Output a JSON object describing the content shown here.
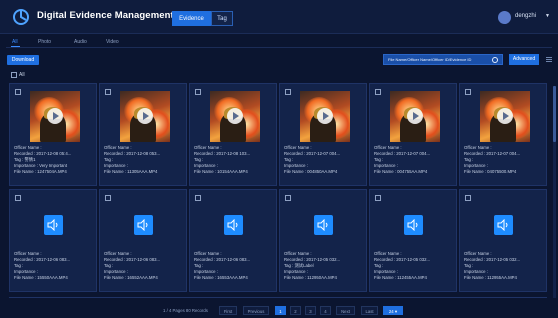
{
  "header": {
    "app_title": "Digital Evidence Management",
    "tabs": [
      {
        "label": "Evidence",
        "active": true
      },
      {
        "label": "Tag",
        "active": false
      }
    ],
    "user": {
      "name": "dengzhi"
    }
  },
  "filter_tabs": [
    {
      "label": "All",
      "active": true
    },
    {
      "label": "Photo",
      "active": false
    },
    {
      "label": "Audio",
      "active": false
    },
    {
      "label": "Video",
      "active": false
    }
  ],
  "toolbar": {
    "download_label": "Download",
    "search_placeholder": "File Name/Officer Name/Officer ID/Evidence ID",
    "advanced_label": "Advanced"
  },
  "select_all_label": "All",
  "cards": [
    {
      "type": "video",
      "officer": "Officer Name :",
      "recorded": "Recorded : 2017-12-08 05:4...",
      "tag": "Tag : 警情1",
      "importance": "Importance : Very Important",
      "file": "File Name : 1247504A.MP4"
    },
    {
      "type": "video",
      "officer": "Officer Name :",
      "recorded": "Recorded : 2017-12-08 053...",
      "tag": "Tag :",
      "importance": "Importance :",
      "file": "File Name : 11305AAA.MP4"
    },
    {
      "type": "video",
      "officer": "Officer Name :",
      "recorded": "Recorded : 2017-12-08 103...",
      "tag": "Tag :",
      "importance": "Importance :",
      "file": "File Name : 10154AAA.MP4"
    },
    {
      "type": "video",
      "officer": "Officer Name :",
      "recorded": "Recorded : 2017-12-07 004...",
      "tag": "Tag :",
      "importance": "Importance :",
      "file": "File Name : 004850AA.MP4"
    },
    {
      "type": "video",
      "officer": "Officer Name :",
      "recorded": "Recorded : 2017-12-07 004...",
      "tag": "Tag :",
      "importance": "Importance :",
      "file": "File Name : 004755AA.MP4"
    },
    {
      "type": "video",
      "officer": "Officer Name :",
      "recorded": "Recorded : 2017-12-07 004...",
      "tag": "Tag :",
      "importance": "Importance :",
      "file": "File Name : 04075500.MP4"
    },
    {
      "type": "audio",
      "officer": "Officer Name :",
      "recorded": "Recorded : 2017-12-06 083...",
      "tag": "Tag :",
      "importance": "Importance :",
      "file": "File Name : 15550AAA.MP4"
    },
    {
      "type": "audio",
      "officer": "Officer Name :",
      "recorded": "Recorded : 2017-12-06 083...",
      "tag": "Tag :",
      "importance": "Importance :",
      "file": "File Name : 16552AAA.MP4"
    },
    {
      "type": "audio",
      "officer": "Officer Name :",
      "recorded": "Recorded : 2017-12-06 083...",
      "tag": "Tag :",
      "importance": "Importance :",
      "file": "File Name : 16553AAA.MP4"
    },
    {
      "type": "audio",
      "officer": "Officer Name :",
      "recorded": "Recorded : 2017-12-05 032...",
      "tag": "Tag : 测试Label",
      "importance": "Importance :",
      "file": "File Name : 112950AA.MP4"
    },
    {
      "type": "audio",
      "officer": "Officer Name :",
      "recorded": "Recorded : 2017-12-05 032...",
      "tag": "Tag :",
      "importance": "Importance :",
      "file": "File Name : 112455AA.MP4"
    },
    {
      "type": "audio",
      "officer": "Officer Name :",
      "recorded": "Recorded : 2017-12-05 032...",
      "tag": "Tag :",
      "importance": "Importance :",
      "file": "File Name : 112955AA.MP4"
    }
  ],
  "pagination": {
    "info": "1 / 4 Pages 80 Records",
    "first": "First",
    "previous": "Previous",
    "pages": [
      "1",
      "2",
      "3",
      "4"
    ],
    "current_page": "1",
    "next": "Next",
    "last": "Last",
    "page_size": "24 ▾"
  },
  "colors": {
    "accent": "#1f6fe0",
    "background": "#0b1530",
    "card": "#13234a"
  }
}
